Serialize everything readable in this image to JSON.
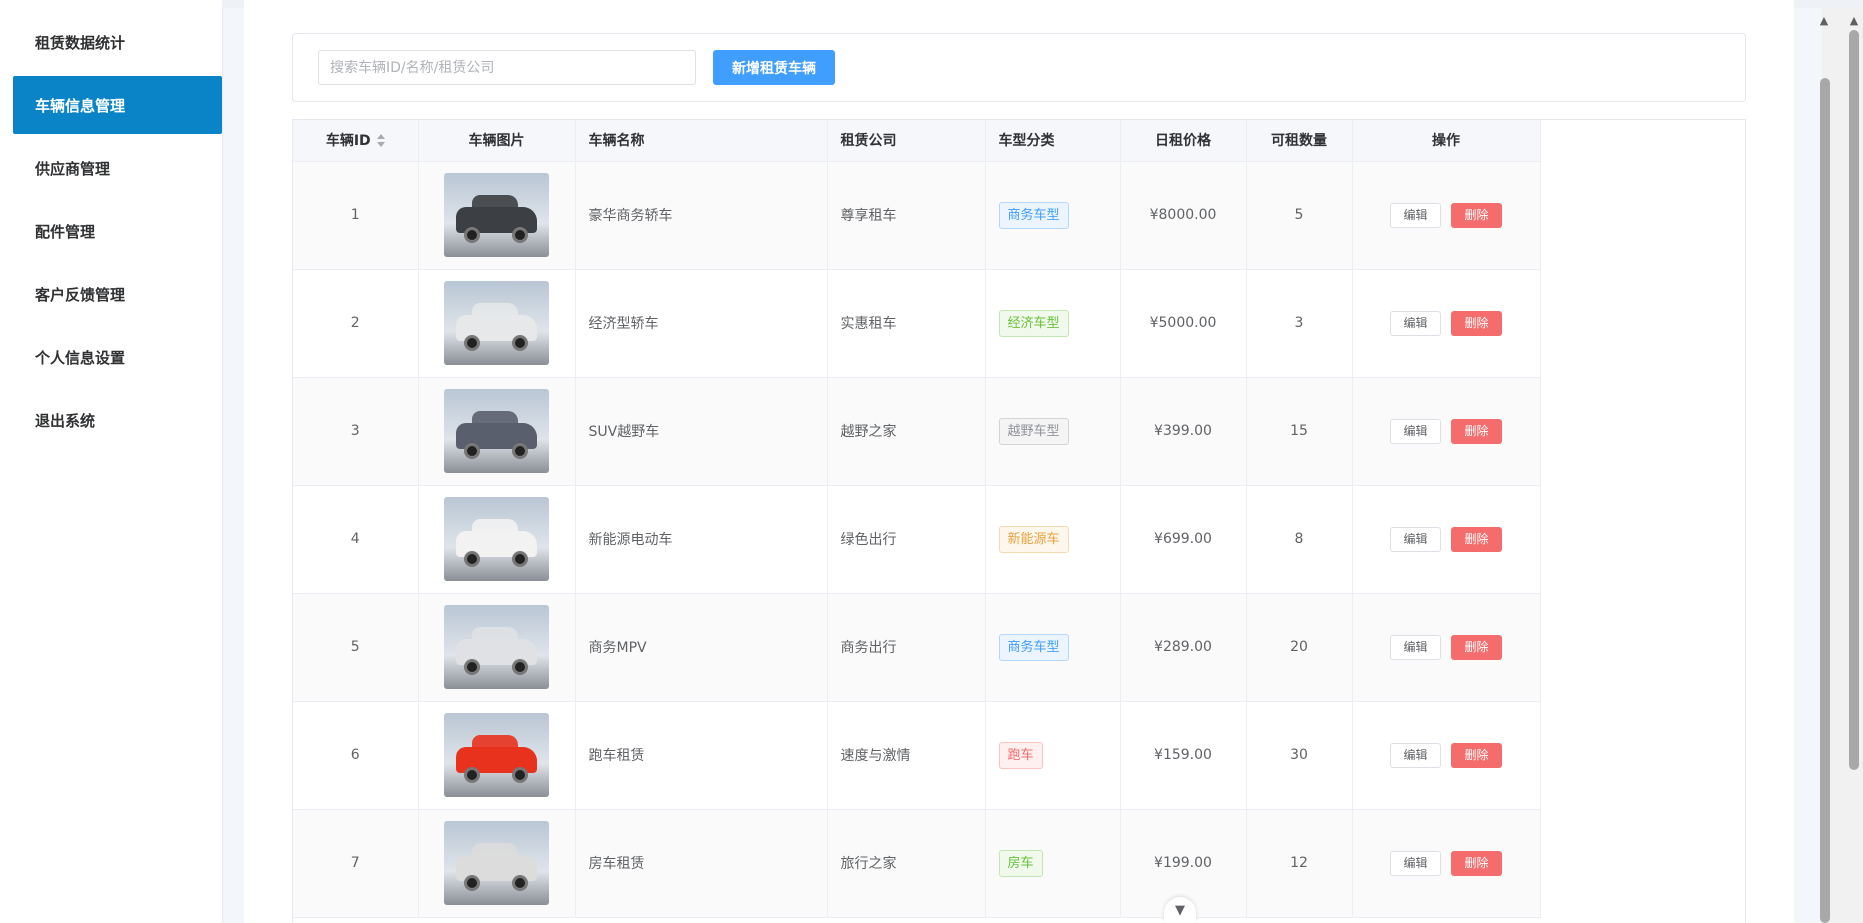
{
  "sidebar": {
    "items": [
      {
        "label": "租赁数据统计",
        "active": false
      },
      {
        "label": "车辆信息管理",
        "active": true
      },
      {
        "label": "供应商管理",
        "active": false
      },
      {
        "label": "配件管理",
        "active": false
      },
      {
        "label": "客户反馈管理",
        "active": false
      },
      {
        "label": "个人信息设置",
        "active": false
      },
      {
        "label": "退出系统",
        "active": false
      }
    ]
  },
  "search": {
    "placeholder": "搜索车辆ID/名称/租赁公司",
    "value": "",
    "add_label": "新增租赁车辆"
  },
  "table": {
    "columns": [
      "车辆ID",
      "车辆图片",
      "车辆名称",
      "租赁公司",
      "车型分类",
      "日租价格",
      "可租数量",
      "操作"
    ],
    "edit_label": "编辑",
    "delete_label": "删除",
    "rows": [
      {
        "id": "1",
        "name": "豪华商务轿车",
        "company": "尊享租车",
        "category": "商务车型",
        "tag_color": "blue",
        "price": "¥8000.00",
        "count": "5",
        "img_color": "#3c3f44"
      },
      {
        "id": "2",
        "name": "经济型轿车",
        "company": "实惠租车",
        "category": "经济车型",
        "tag_color": "green",
        "price": "¥5000.00",
        "count": "3",
        "img_color": "#e6e8ea"
      },
      {
        "id": "3",
        "name": "SUV越野车",
        "company": "越野之家",
        "category": "越野车型",
        "tag_color": "gray",
        "price": "¥399.00",
        "count": "15",
        "img_color": "#5a5f6e"
      },
      {
        "id": "4",
        "name": "新能源电动车",
        "company": "绿色出行",
        "category": "新能源车",
        "tag_color": "orange",
        "price": "¥699.00",
        "count": "8",
        "img_color": "#f2f2f2"
      },
      {
        "id": "5",
        "name": "商务MPV",
        "company": "商务出行",
        "category": "商务车型",
        "tag_color": "blue",
        "price": "¥289.00",
        "count": "20",
        "img_color": "#dfe1e4"
      },
      {
        "id": "6",
        "name": "跑车租赁",
        "company": "速度与激情",
        "category": "跑车",
        "tag_color": "red",
        "price": "¥159.00",
        "count": "30",
        "img_color": "#e8321e"
      },
      {
        "id": "7",
        "name": "房车租赁",
        "company": "旅行之家",
        "category": "房车",
        "tag_color": "green",
        "price": "¥199.00",
        "count": "12",
        "img_color": "#dcdcdc"
      }
    ]
  },
  "icons": {
    "sort": "sort-icon",
    "expand": "chevron-down-icon",
    "scroll_up": "triangle-up-icon"
  },
  "colors": {
    "accent": "#409eff",
    "active_menu": "#0a84c6",
    "danger": "#f56c6c"
  }
}
